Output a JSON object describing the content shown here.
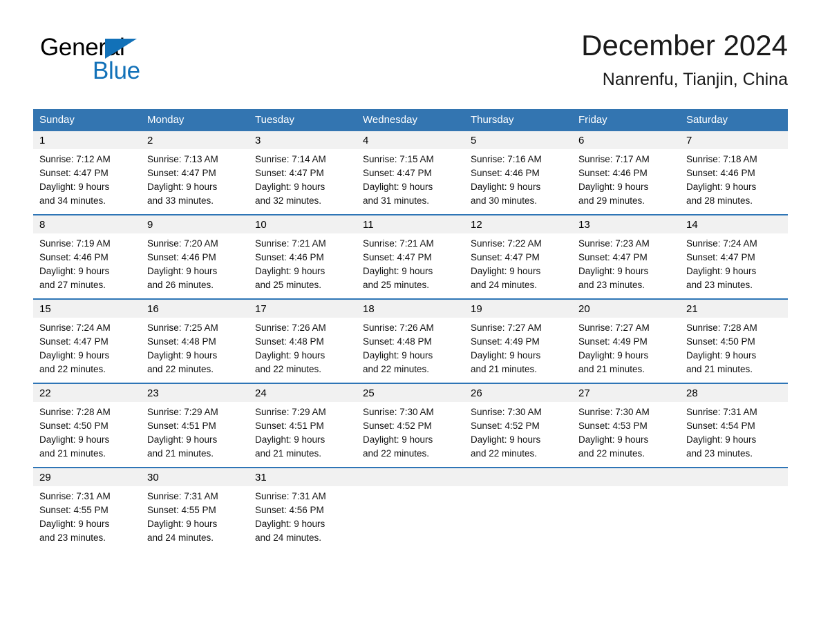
{
  "brand": {
    "name_part1": "General",
    "name_part2": "Blue",
    "triangle_color": "#1271B8"
  },
  "header": {
    "month_title": "December 2024",
    "location": "Nanrenfu, Tianjin, China"
  },
  "theme": {
    "header_blue": "#3375B1",
    "row_rule_blue": "#2E75B6",
    "date_band_gray": "#F1F1F1"
  },
  "calendar": {
    "day_headers": [
      "Sunday",
      "Monday",
      "Tuesday",
      "Wednesday",
      "Thursday",
      "Friday",
      "Saturday"
    ],
    "weeks": [
      {
        "days": [
          {
            "date": "1",
            "lines": [
              "Sunrise: 7:12 AM",
              "Sunset: 4:47 PM",
              "Daylight: 9 hours",
              "and 34 minutes."
            ]
          },
          {
            "date": "2",
            "lines": [
              "Sunrise: 7:13 AM",
              "Sunset: 4:47 PM",
              "Daylight: 9 hours",
              "and 33 minutes."
            ]
          },
          {
            "date": "3",
            "lines": [
              "Sunrise: 7:14 AM",
              "Sunset: 4:47 PM",
              "Daylight: 9 hours",
              "and 32 minutes."
            ]
          },
          {
            "date": "4",
            "lines": [
              "Sunrise: 7:15 AM",
              "Sunset: 4:47 PM",
              "Daylight: 9 hours",
              "and 31 minutes."
            ]
          },
          {
            "date": "5",
            "lines": [
              "Sunrise: 7:16 AM",
              "Sunset: 4:46 PM",
              "Daylight: 9 hours",
              "and 30 minutes."
            ]
          },
          {
            "date": "6",
            "lines": [
              "Sunrise: 7:17 AM",
              "Sunset: 4:46 PM",
              "Daylight: 9 hours",
              "and 29 minutes."
            ]
          },
          {
            "date": "7",
            "lines": [
              "Sunrise: 7:18 AM",
              "Sunset: 4:46 PM",
              "Daylight: 9 hours",
              "and 28 minutes."
            ]
          }
        ]
      },
      {
        "days": [
          {
            "date": "8",
            "lines": [
              "Sunrise: 7:19 AM",
              "Sunset: 4:46 PM",
              "Daylight: 9 hours",
              "and 27 minutes."
            ]
          },
          {
            "date": "9",
            "lines": [
              "Sunrise: 7:20 AM",
              "Sunset: 4:46 PM",
              "Daylight: 9 hours",
              "and 26 minutes."
            ]
          },
          {
            "date": "10",
            "lines": [
              "Sunrise: 7:21 AM",
              "Sunset: 4:46 PM",
              "Daylight: 9 hours",
              "and 25 minutes."
            ]
          },
          {
            "date": "11",
            "lines": [
              "Sunrise: 7:21 AM",
              "Sunset: 4:47 PM",
              "Daylight: 9 hours",
              "and 25 minutes."
            ]
          },
          {
            "date": "12",
            "lines": [
              "Sunrise: 7:22 AM",
              "Sunset: 4:47 PM",
              "Daylight: 9 hours",
              "and 24 minutes."
            ]
          },
          {
            "date": "13",
            "lines": [
              "Sunrise: 7:23 AM",
              "Sunset: 4:47 PM",
              "Daylight: 9 hours",
              "and 23 minutes."
            ]
          },
          {
            "date": "14",
            "lines": [
              "Sunrise: 7:24 AM",
              "Sunset: 4:47 PM",
              "Daylight: 9 hours",
              "and 23 minutes."
            ]
          }
        ]
      },
      {
        "days": [
          {
            "date": "15",
            "lines": [
              "Sunrise: 7:24 AM",
              "Sunset: 4:47 PM",
              "Daylight: 9 hours",
              "and 22 minutes."
            ]
          },
          {
            "date": "16",
            "lines": [
              "Sunrise: 7:25 AM",
              "Sunset: 4:48 PM",
              "Daylight: 9 hours",
              "and 22 minutes."
            ]
          },
          {
            "date": "17",
            "lines": [
              "Sunrise: 7:26 AM",
              "Sunset: 4:48 PM",
              "Daylight: 9 hours",
              "and 22 minutes."
            ]
          },
          {
            "date": "18",
            "lines": [
              "Sunrise: 7:26 AM",
              "Sunset: 4:48 PM",
              "Daylight: 9 hours",
              "and 22 minutes."
            ]
          },
          {
            "date": "19",
            "lines": [
              "Sunrise: 7:27 AM",
              "Sunset: 4:49 PM",
              "Daylight: 9 hours",
              "and 21 minutes."
            ]
          },
          {
            "date": "20",
            "lines": [
              "Sunrise: 7:27 AM",
              "Sunset: 4:49 PM",
              "Daylight: 9 hours",
              "and 21 minutes."
            ]
          },
          {
            "date": "21",
            "lines": [
              "Sunrise: 7:28 AM",
              "Sunset: 4:50 PM",
              "Daylight: 9 hours",
              "and 21 minutes."
            ]
          }
        ]
      },
      {
        "days": [
          {
            "date": "22",
            "lines": [
              "Sunrise: 7:28 AM",
              "Sunset: 4:50 PM",
              "Daylight: 9 hours",
              "and 21 minutes."
            ]
          },
          {
            "date": "23",
            "lines": [
              "Sunrise: 7:29 AM",
              "Sunset: 4:51 PM",
              "Daylight: 9 hours",
              "and 21 minutes."
            ]
          },
          {
            "date": "24",
            "lines": [
              "Sunrise: 7:29 AM",
              "Sunset: 4:51 PM",
              "Daylight: 9 hours",
              "and 21 minutes."
            ]
          },
          {
            "date": "25",
            "lines": [
              "Sunrise: 7:30 AM",
              "Sunset: 4:52 PM",
              "Daylight: 9 hours",
              "and 22 minutes."
            ]
          },
          {
            "date": "26",
            "lines": [
              "Sunrise: 7:30 AM",
              "Sunset: 4:52 PM",
              "Daylight: 9 hours",
              "and 22 minutes."
            ]
          },
          {
            "date": "27",
            "lines": [
              "Sunrise: 7:30 AM",
              "Sunset: 4:53 PM",
              "Daylight: 9 hours",
              "and 22 minutes."
            ]
          },
          {
            "date": "28",
            "lines": [
              "Sunrise: 7:31 AM",
              "Sunset: 4:54 PM",
              "Daylight: 9 hours",
              "and 23 minutes."
            ]
          }
        ]
      },
      {
        "days": [
          {
            "date": "29",
            "lines": [
              "Sunrise: 7:31 AM",
              "Sunset: 4:55 PM",
              "Daylight: 9 hours",
              "and 23 minutes."
            ]
          },
          {
            "date": "30",
            "lines": [
              "Sunrise: 7:31 AM",
              "Sunset: 4:55 PM",
              "Daylight: 9 hours",
              "and 24 minutes."
            ]
          },
          {
            "date": "31",
            "lines": [
              "Sunrise: 7:31 AM",
              "Sunset: 4:56 PM",
              "Daylight: 9 hours",
              "and 24 minutes."
            ]
          },
          {
            "date": "",
            "lines": []
          },
          {
            "date": "",
            "lines": []
          },
          {
            "date": "",
            "lines": []
          },
          {
            "date": "",
            "lines": []
          }
        ]
      }
    ]
  }
}
